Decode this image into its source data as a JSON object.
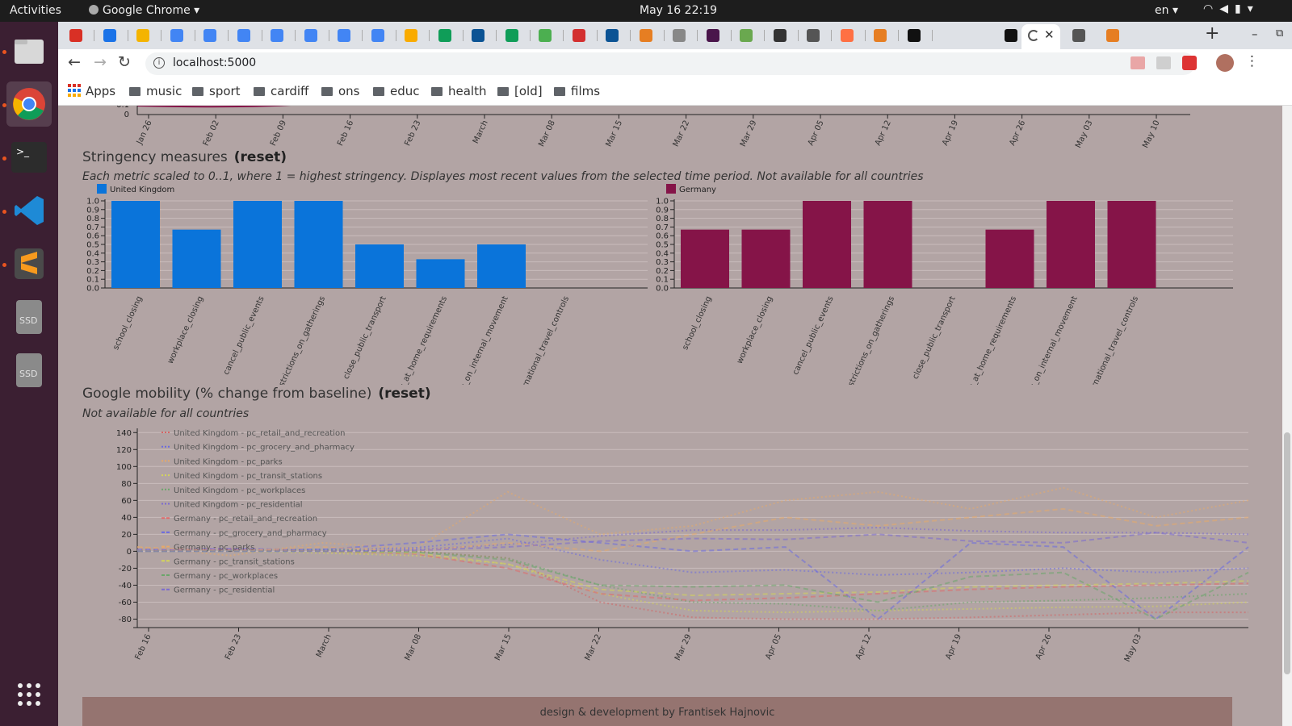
{
  "os": {
    "activities": "Activities",
    "app_name": "Google Chrome",
    "clock": "May 16  22:19",
    "lang": "en"
  },
  "browser": {
    "url": "localhost:5000",
    "bookmarks": [
      "Apps",
      "music",
      "sport",
      "cardiff",
      "ons",
      "educ",
      "health",
      "[old]",
      "films"
    ]
  },
  "timeline": {
    "ticks": [
      "Jan 26",
      "Feb 02",
      "Feb 09",
      "Feb 16",
      "Feb 23",
      "March",
      "Mar 08",
      "Mar 15",
      "Mar 22",
      "Mar 29",
      "Apr 05",
      "Apr 12",
      "Apr 19",
      "Apr 26",
      "May 03",
      "May 10"
    ]
  },
  "stringency": {
    "title": "Stringency measures",
    "reset": "(reset)",
    "subtitle": "Each metric scaled to 0..1, where 1 = highest stringency.  Displayes most recent values from the selected time period.  Not available for all countries"
  },
  "mobility": {
    "title": "Google mobility (% change from baseline)",
    "reset": "(reset)",
    "subtitle": "Not available for all countries"
  },
  "footer": "design & development by  Frantisek  Hajnovic",
  "chart_data": [
    {
      "type": "bar",
      "legend": "United Kingdom",
      "color": "#0a74da",
      "categories": [
        "school_closing",
        "workplace_closing",
        "cancel_public_events",
        "restrictions_on_gatherings",
        "close_public_transport",
        "stay_at_home_requirements",
        "restrictions_on_internal_movement",
        "international_travel_controls"
      ],
      "values": [
        1.0,
        0.67,
        1.0,
        1.0,
        0.5,
        0.33,
        0.5,
        0
      ],
      "yticks": [
        "0.0",
        "0.1",
        "0.2",
        "0.3",
        "0.4",
        "0.5",
        "0.6",
        "0.7",
        "0.8",
        "0.9",
        "1.0"
      ],
      "ylim": [
        0,
        1
      ]
    },
    {
      "type": "bar",
      "legend": "Germany",
      "color": "#851448",
      "categories": [
        "school_closing",
        "workplace_closing",
        "cancel_public_events",
        "restrictions_on_gatherings",
        "close_public_transport",
        "stay_at_home_requirements",
        "restrictions_on_internal_movement",
        "international_travel_controls"
      ],
      "values": [
        0.67,
        0.67,
        1.0,
        1.0,
        0,
        0.67,
        1.0,
        1.0
      ],
      "yticks": [
        "0.0",
        "0.1",
        "0.2",
        "0.3",
        "0.4",
        "0.5",
        "0.6",
        "0.7",
        "0.8",
        "0.9",
        "1.0"
      ],
      "ylim": [
        0,
        1
      ]
    },
    {
      "type": "line",
      "xticks": [
        "Feb 16",
        "Feb 23",
        "March",
        "Mar 08",
        "Mar 15",
        "Mar 22",
        "Mar 29",
        "Apr 05",
        "Apr 12",
        "Apr 19",
        "Apr 26",
        "May 03"
      ],
      "yticks": [
        "-80",
        "-60",
        "-40",
        "-20",
        "0",
        "20",
        "40",
        "60",
        "80",
        "100",
        "120",
        "140"
      ],
      "ylim": [
        -90,
        145
      ],
      "series": [
        {
          "name": "United Kingdom - pc_retail_and_recreation",
          "color": "#d46464",
          "dash": "dot",
          "values": [
            2,
            3,
            1,
            0,
            -8,
            -60,
            -78,
            -80,
            -80,
            -78,
            -75,
            -72,
            -72
          ]
        },
        {
          "name": "United Kingdom - pc_grocery_and_pharmacy",
          "color": "#6a6ae0",
          "dash": "dot",
          "values": [
            1,
            2,
            2,
            4,
            15,
            -10,
            -25,
            -22,
            -28,
            -25,
            -20,
            -25,
            -20
          ]
        },
        {
          "name": "United Kingdom - pc_parks",
          "color": "#e6a96a",
          "dash": "dot",
          "values": [
            5,
            -5,
            10,
            3,
            70,
            20,
            30,
            60,
            70,
            50,
            75,
            40,
            60
          ]
        },
        {
          "name": "United Kingdom - pc_transit_stations",
          "color": "#d4d45a",
          "dash": "dot",
          "values": [
            1,
            0,
            -2,
            -5,
            -15,
            -50,
            -70,
            -72,
            -70,
            -68,
            -66,
            -65,
            -60
          ]
        },
        {
          "name": "United Kingdom - pc_workplaces",
          "color": "#6aa66a",
          "dash": "dot",
          "values": [
            0,
            1,
            2,
            0,
            -8,
            -40,
            -60,
            -62,
            -70,
            -60,
            -58,
            -55,
            -50
          ]
        },
        {
          "name": "United Kingdom - pc_residential",
          "color": "#7a6ad0",
          "dash": "dot",
          "values": [
            0,
            0,
            0,
            2,
            8,
            18,
            25,
            25,
            28,
            24,
            22,
            22,
            20
          ]
        },
        {
          "name": "Germany - pc_retail_and_recreation",
          "color": "#e06a6a",
          "dash": "dash",
          "values": [
            0,
            2,
            0,
            -3,
            -20,
            -50,
            -58,
            -55,
            -50,
            -45,
            -42,
            -40,
            -38
          ]
        },
        {
          "name": "Germany - pc_grocery_and_pharmacy",
          "color": "#6a6ae0",
          "dash": "dash",
          "values": [
            2,
            3,
            2,
            10,
            20,
            10,
            0,
            5,
            -80,
            10,
            5,
            -80,
            5
          ]
        },
        {
          "name": "Germany - pc_parks",
          "color": "#e6a96a",
          "dash": "dash",
          "values": [
            5,
            0,
            5,
            0,
            10,
            0,
            20,
            40,
            30,
            40,
            50,
            30,
            40
          ]
        },
        {
          "name": "Germany - pc_transit_stations",
          "color": "#d4d45a",
          "dash": "dash",
          "values": [
            0,
            0,
            0,
            -2,
            -15,
            -45,
            -52,
            -50,
            -48,
            -42,
            -40,
            -38,
            -35
          ]
        },
        {
          "name": "Germany - pc_workplaces",
          "color": "#6aa66a",
          "dash": "dash",
          "values": [
            0,
            0,
            0,
            -1,
            -10,
            -40,
            -42,
            -40,
            -60,
            -30,
            -25,
            -80,
            -25
          ]
        },
        {
          "name": "Germany - pc_residential",
          "color": "#7a6ad0",
          "dash": "dash",
          "values": [
            0,
            0,
            0,
            1,
            5,
            12,
            15,
            14,
            20,
            12,
            10,
            22,
            10
          ]
        }
      ]
    }
  ]
}
